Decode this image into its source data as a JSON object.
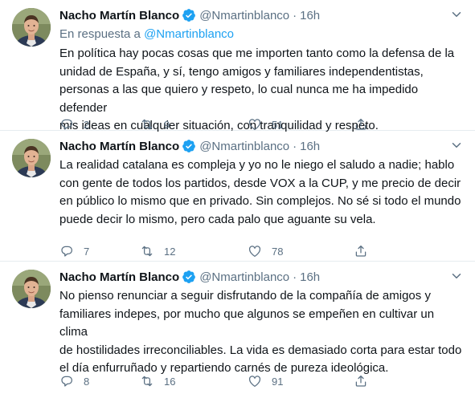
{
  "colors": {
    "accent": "#1da1f2",
    "muted": "#5b7083",
    "text": "#0f1419"
  },
  "tweets": [
    {
      "name": "Nacho Martín Blanco",
      "handle": "@Nmartinblanco",
      "time": "16h",
      "reply_prefix": "En respuesta a",
      "reply_handle": "@Nmartinblanco",
      "text_lines": [
        "En política hay pocas cosas que me importen tanto como la defensa de la",
        "unidad de España, y sí, tengo amigos y familiares independentistas,",
        "personas a las que quiero y respeto, lo cual nunca me ha impedido defender",
        "mis ideas en cualquier situación, con tranquilidad y respeto."
      ],
      "replies": "2",
      "retweets": "9",
      "likes": "51"
    },
    {
      "name": "Nacho Martín Blanco",
      "handle": "@Nmartinblanco",
      "time": "16h",
      "text_lines": [
        "La realidad catalana es compleja y yo no le niego el saludo a nadie; hablo",
        "con gente de todos los partidos, desde VOX a la CUP, y me precio de decir",
        "en público lo mismo que en privado. Sin complejos. No sé si todo el mundo",
        "puede decir lo mismo, pero cada palo que aguante su vela."
      ],
      "replies": "7",
      "retweets": "12",
      "likes": "78"
    },
    {
      "name": "Nacho Martín Blanco",
      "handle": "@Nmartinblanco",
      "time": "16h",
      "text_lines": [
        "No pienso renunciar a seguir disfrutando de la compañía de amigos y",
        "familiares indepes, por mucho que algunos se empeñen en cultivar un clima",
        "de hostilidades irreconciliables. La vida es demasiado corta para estar todo",
        "el día enfurruñado y repartiendo carnés de pureza ideológica."
      ],
      "replies": "8",
      "retweets": "16",
      "likes": "91"
    }
  ],
  "icons": [
    "avatar-photo",
    "verified-badge-icon",
    "more-caret-icon",
    "reply-icon",
    "retweet-icon",
    "like-icon",
    "share-icon"
  ]
}
